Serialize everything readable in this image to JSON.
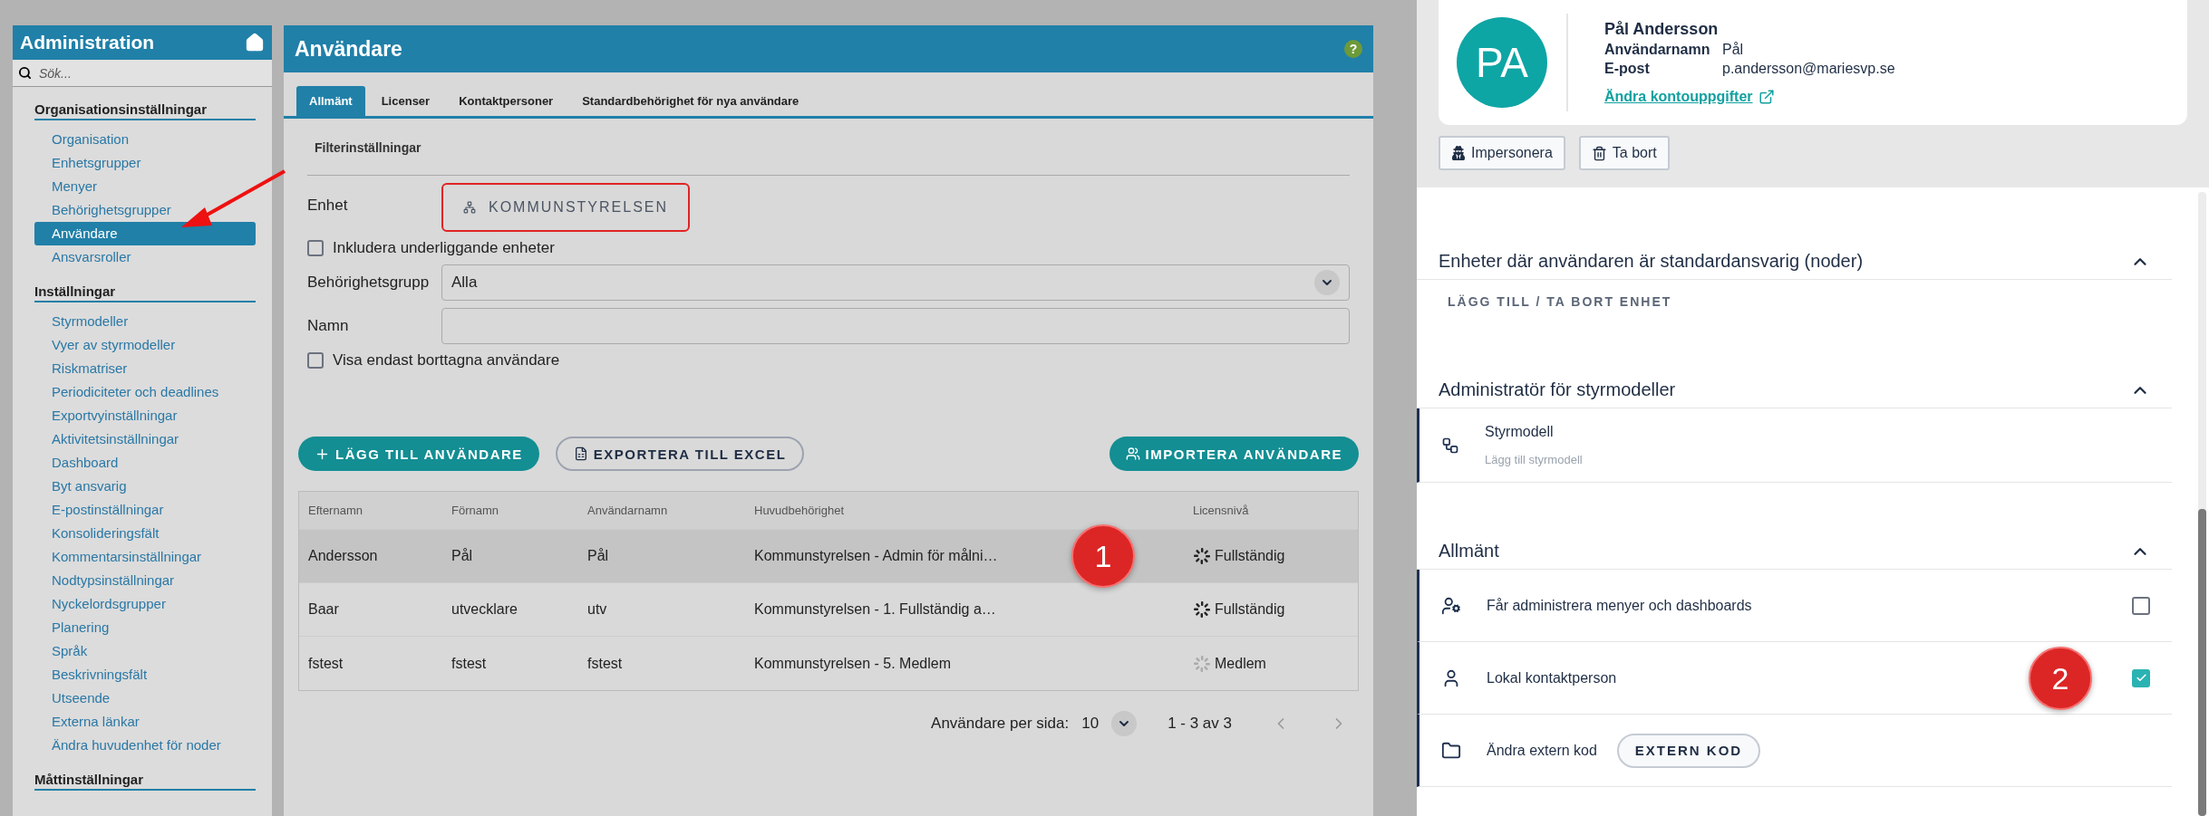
{
  "sidebar": {
    "title": "Administration",
    "search": {
      "placeholder": "Sök..."
    },
    "sections": [
      {
        "title": "Organisationsinställningar",
        "items": [
          {
            "label": "Organisation",
            "selected": false
          },
          {
            "label": "Enhetsgrupper",
            "selected": false
          },
          {
            "label": "Menyer",
            "selected": false
          },
          {
            "label": "Behörighetsgrupper",
            "selected": false
          },
          {
            "label": "Användare",
            "selected": true,
            "arrow": true
          },
          {
            "label": "Ansvarsroller",
            "selected": false
          }
        ]
      },
      {
        "title": "Inställningar",
        "items": [
          {
            "label": "Styrmodeller",
            "selected": false
          },
          {
            "label": "Vyer av styrmodeller",
            "selected": false
          },
          {
            "label": "Riskmatriser",
            "selected": false
          },
          {
            "label": "Periodiciteter och deadlines",
            "selected": false
          },
          {
            "label": "Exportvyinställningar",
            "selected": false
          },
          {
            "label": "Aktivitetsinställningar",
            "selected": false
          },
          {
            "label": "Dashboard",
            "selected": false
          },
          {
            "label": "Byt ansvarig",
            "selected": false
          },
          {
            "label": "E-postinställningar",
            "selected": false
          },
          {
            "label": "Konsolideringsfält",
            "selected": false
          },
          {
            "label": "Kommentarsinställningar",
            "selected": false
          },
          {
            "label": "Nodtypsinställningar",
            "selected": false
          },
          {
            "label": "Nyckelordsgrupper",
            "selected": false
          },
          {
            "label": "Planering",
            "selected": false
          },
          {
            "label": "Språk",
            "selected": false
          },
          {
            "label": "Beskrivningsfält",
            "selected": false
          },
          {
            "label": "Utseende",
            "selected": false
          },
          {
            "label": "Externa länkar",
            "selected": false
          },
          {
            "label": "Ändra huvudenhet för noder",
            "selected": false
          }
        ]
      },
      {
        "title": "Måttinställningar"
      }
    ]
  },
  "main": {
    "title": "Användare",
    "help": "?",
    "tabs": [
      {
        "label": "Allmänt",
        "selected": true
      },
      {
        "label": "Licenser",
        "selected": false
      },
      {
        "label": "Kontaktpersoner",
        "selected": false
      },
      {
        "label": "Standardbehörighet för nya användare",
        "selected": false
      }
    ],
    "filter": {
      "heading": "Filterinställningar",
      "unit": {
        "label": "Enhet",
        "value": "KOMMUNSTYRELSEN",
        "highlighted": true
      },
      "include_sub": {
        "label": "Inkludera underliggande enheter",
        "checked": false
      },
      "group": {
        "label": "Behörighetsgrupp",
        "value": "Alla"
      },
      "name": {
        "label": "Namn"
      },
      "deleted_only": {
        "label": "Visa endast borttagna användare",
        "checked": false
      }
    },
    "buttons": [
      {
        "kind": "add",
        "label": "LÄGG TILL ANVÄNDARE"
      },
      {
        "kind": "export",
        "label": "EXPORTERA TILL EXCEL"
      },
      {
        "kind": "import",
        "label": "IMPORTERA ANVÄNDARE"
      }
    ],
    "table": {
      "columns": [
        "Efternamn",
        "Förnamn",
        "Användarnamn",
        "Huvudbehörighet",
        "Licensnivå"
      ],
      "rows": [
        {
          "cells": [
            "Andersson",
            "Pål",
            "Pål",
            "Kommunstyrelsen - Admin för målni…"
          ],
          "license": {
            "kind": "full",
            "label": "Fullständig"
          },
          "selected": true,
          "callout": "1"
        },
        {
          "cells": [
            "Baar",
            "utvecklare",
            "utv",
            "Kommunstyrelsen - 1. Fullständig a…"
          ],
          "license": {
            "kind": "full",
            "label": "Fullständig"
          },
          "selected": false
        },
        {
          "cells": [
            "fstest",
            "fstest",
            "fstest",
            "Kommunstyrelsen - 5. Medlem"
          ],
          "license": {
            "kind": "member",
            "label": "Medlem"
          },
          "selected": false
        }
      ]
    },
    "pagination": {
      "label": "Användare per sida:",
      "value": "10",
      "range": "1 - 3 av 3"
    }
  },
  "profile": {
    "initials": "PA",
    "name": "Pål Andersson",
    "fields": [
      {
        "label": "Användarnamn",
        "value": "Pål"
      },
      {
        "label": "E-post",
        "value": "p.andersson@mariesvp.se"
      }
    ],
    "link": "Ändra kontouppgifter",
    "actions": [
      {
        "kind": "impersonate",
        "label": "Impersonera"
      },
      {
        "kind": "delete",
        "label": "Ta bort"
      }
    ],
    "sections": [
      {
        "title": "Enheter där användaren är standardansvarig (noder)",
        "expanded": true,
        "items": [
          {
            "kind": "action",
            "label": "LÄGG TILL / TA BORT ENHET"
          }
        ]
      },
      {
        "title": "Administratör för styrmodeller",
        "expanded": true,
        "items": [
          {
            "kind": "model",
            "label": "Styrmodell",
            "hint": "Lägg till styrmodell"
          }
        ]
      },
      {
        "title": "Allmänt",
        "expanded": true,
        "items": [
          {
            "kind": "checkbox",
            "label": "Får administrera menyer och dashboards",
            "checked": false
          },
          {
            "kind": "checkbox",
            "label": "Lokal kontaktperson",
            "checked": true,
            "callout": "2"
          },
          {
            "kind": "button",
            "label": "Ändra extern kod",
            "button": "EXTERN KOD"
          }
        ]
      }
    ]
  }
}
